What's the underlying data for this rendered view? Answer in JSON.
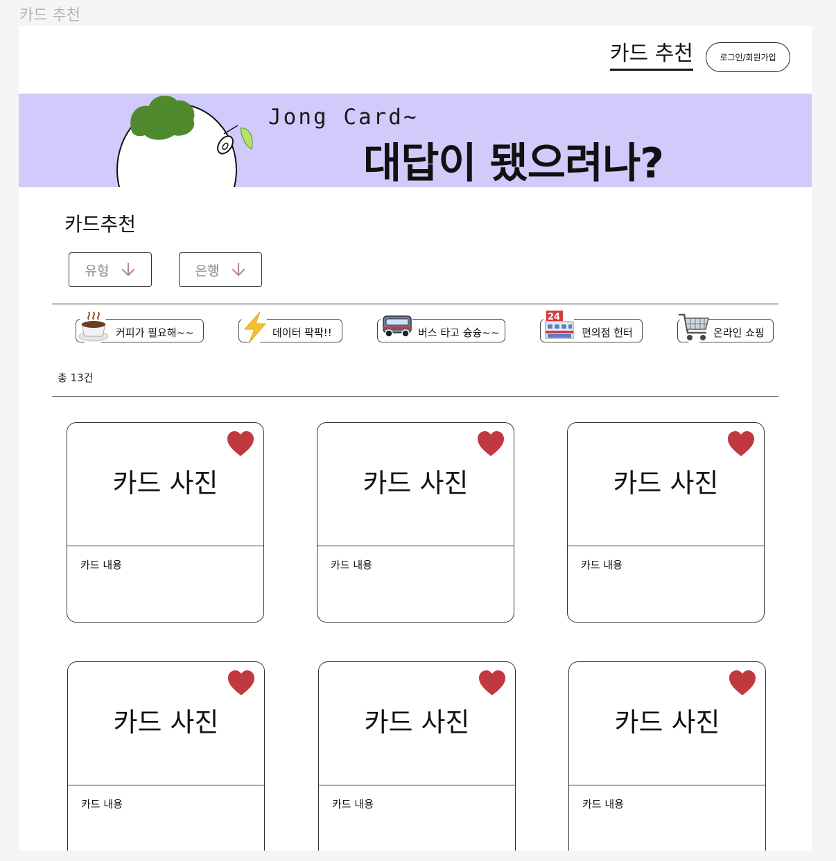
{
  "frame_label": "카드 추천",
  "header": {
    "title": "카드 추천",
    "login_button": "로그인/회원가입"
  },
  "banner": {
    "subtitle": "Jong Card~",
    "headline": "대답이 됐으려나?",
    "background_color": "#d0cbfa"
  },
  "section": {
    "title": "카드추천",
    "filters": [
      {
        "label": "유형",
        "icon": "arrow-down-icon"
      },
      {
        "label": "은행",
        "icon": "arrow-down-icon"
      }
    ],
    "categories": [
      {
        "label": "커피가 필요해~~",
        "icon": "coffee-cup-icon"
      },
      {
        "label": "데이터 팍팍!!",
        "icon": "lightning-icon"
      },
      {
        "label": "버스 타고 슝슝~~",
        "icon": "bus-icon"
      },
      {
        "label": "편의점 헌터",
        "icon": "convenience-store-icon"
      },
      {
        "label": "온라인 쇼핑",
        "icon": "shopping-cart-icon"
      }
    ],
    "total_count": "총 13건"
  },
  "cards": [
    {
      "image_label": "카드 사진",
      "content": "카드 내용",
      "icon": "heart-icon"
    },
    {
      "image_label": "카드 사진",
      "content": "카드 내용",
      "icon": "heart-icon"
    },
    {
      "image_label": "카드 사진",
      "content": "카드 내용",
      "icon": "heart-icon"
    },
    {
      "image_label": "카드 사진",
      "content": "카드 내용",
      "icon": "heart-icon"
    },
    {
      "image_label": "카드 사진",
      "content": "카드 내용",
      "icon": "heart-icon"
    },
    {
      "image_label": "카드 사진",
      "content": "카드 내용",
      "icon": "heart-icon"
    }
  ],
  "colors": {
    "heart": "#c0393f",
    "arrow": "#b48a8f",
    "leaf": "#4f8a2e"
  }
}
